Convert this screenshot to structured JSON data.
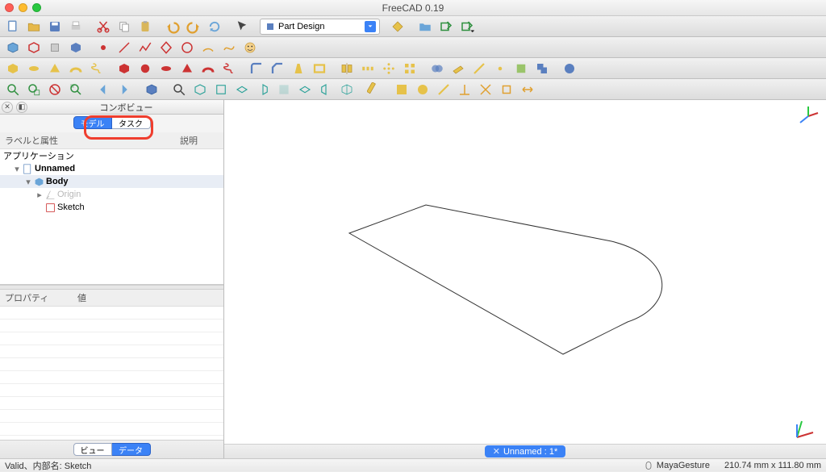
{
  "app_title": "FreeCAD 0.19",
  "workbench": {
    "label": "Part Design"
  },
  "combo_view": {
    "title": "コンボビュー",
    "tabs": {
      "model": "モデル",
      "task": "タスク",
      "active": "model"
    },
    "columns": {
      "label": "ラベルと属性",
      "desc": "説明"
    }
  },
  "tree": {
    "root": "アプリケーション",
    "doc": "Unnamed",
    "body": "Body",
    "origin": "Origin",
    "sketch": "Sketch"
  },
  "property": {
    "columns": {
      "name": "プロパティ",
      "value": "値"
    },
    "bottom_tabs": {
      "view": "ビュー",
      "data": "データ",
      "active": "data"
    }
  },
  "viewport": {
    "tab_label": "Unnamed : 1*"
  },
  "status": {
    "left": "Valid、内部名: Sketch",
    "nav_style": "MayaGesture",
    "dims": "210.74 mm x 111.80 mm"
  },
  "toolbar_icons": {
    "row1": [
      "new-file",
      "open-file",
      "save-file",
      "print",
      "cut",
      "copy",
      "paste",
      "undo",
      "redo",
      "refresh",
      "pointer",
      "workbench-dropdown",
      "measure",
      "folder",
      "export",
      "export-dropdown"
    ],
    "row2": [
      "cube-blue",
      "cube-out",
      "cube-lift",
      "cube-base",
      "sphere-red",
      "line",
      "polyline",
      "diamond",
      "circle",
      "arc",
      "freehand",
      "face",
      "line-red",
      "wire-red",
      "surface",
      "face-red",
      "edge-red",
      "edge-blue",
      "point-red",
      "vertex",
      "revolve",
      "sweep",
      "loft",
      "pocket",
      "groove",
      "hole",
      "chamfer-y",
      "fillet-y",
      "draft-y",
      "mirror",
      "linear",
      "polar",
      "multitransform",
      "boolean",
      "datum-plane",
      "datum-line",
      "datum-point",
      "shapebinder",
      "clone",
      "torus"
    ],
    "row3": [
      "zoom-fit",
      "zoom-window",
      "cancel",
      "zoom-select",
      "nav-left",
      "nav-right",
      "view-cube",
      "zoom",
      "axo",
      "front",
      "top",
      "right",
      "rear",
      "bottom",
      "left-v",
      "iso2",
      "ruler",
      "snap1",
      "snap2",
      "snap3",
      "snap4",
      "snap5",
      "snap6",
      "snap7"
    ]
  }
}
